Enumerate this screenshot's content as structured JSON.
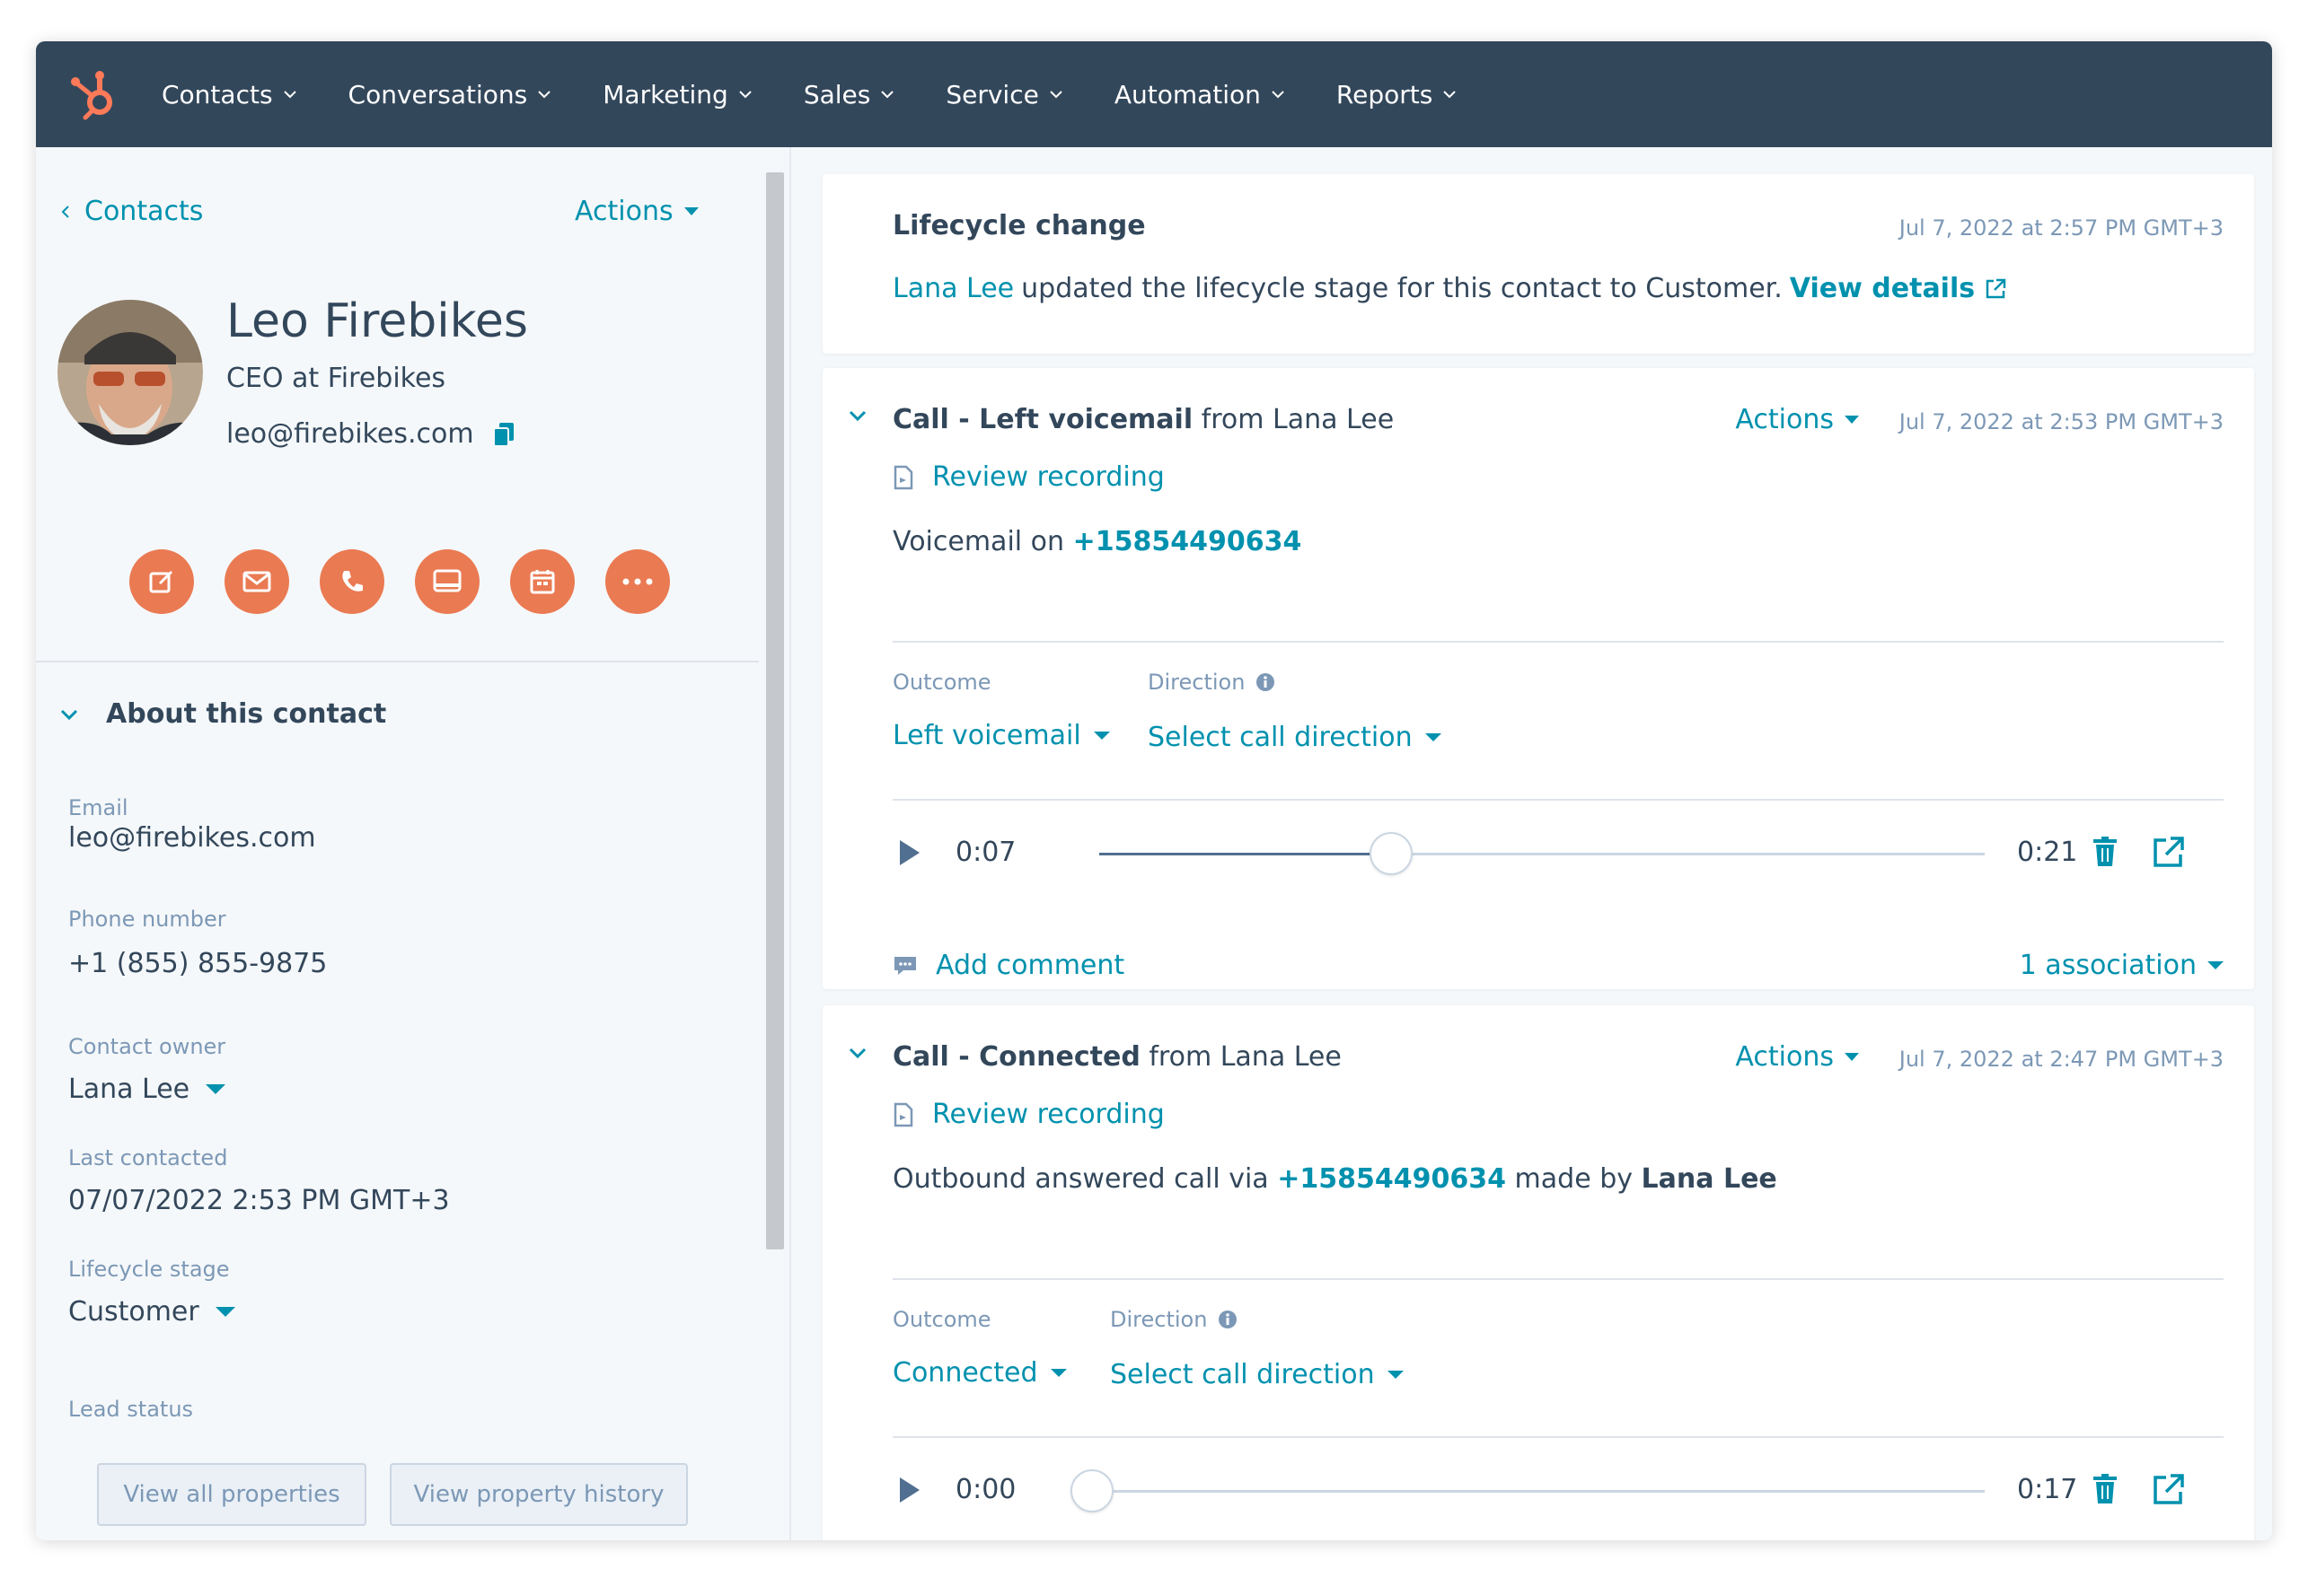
{
  "nav": {
    "items": [
      "Contacts",
      "Conversations",
      "Marketing",
      "Sales",
      "Service",
      "Automation",
      "Reports"
    ]
  },
  "contact": {
    "breadcrumb": "Contacts",
    "actions_label": "Actions",
    "name": "Leo Firebikes",
    "title": "CEO at Firebikes",
    "email": "leo@firebikes.com"
  },
  "about": {
    "heading": "About this contact",
    "email_label": "Email",
    "email_value": "leo@firebikes.com",
    "phone_label": "Phone number",
    "phone_value": "+1 (855) 855-9875",
    "owner_label": "Contact owner",
    "owner_value": "Lana Lee",
    "last_contacted_label": "Last contacted",
    "last_contacted_value": "07/07/2022 2:53 PM GMT+3",
    "lifecycle_label": "Lifecycle stage",
    "lifecycle_value": "Customer",
    "lead_status_label": "Lead status",
    "view_all_btn": "View all properties",
    "view_history_btn": "View property history"
  },
  "timeline": {
    "lifecycle": {
      "title": "Lifecycle change",
      "date": "Jul 7, 2022 at 2:57 PM GMT+3",
      "actor": "Lana Lee",
      "text": "updated the lifecycle stage for this contact to Customer.",
      "view_details": "View details"
    },
    "call1": {
      "title_bold": "Call - Left voicemail",
      "title_rest": "from Lana Lee",
      "actions_label": "Actions",
      "date": "Jul 7, 2022 at 2:53 PM GMT+3",
      "review": "Review recording",
      "body_prefix": "Voicemail on",
      "phone": "+15854490634",
      "outcome_label": "Outcome",
      "direction_label": "Direction",
      "outcome_value": "Left voicemail",
      "direction_value": "Select call direction",
      "time_current": "0:07",
      "time_total": "0:21",
      "progress": 0.33,
      "add_comment": "Add comment",
      "association": "1 association"
    },
    "call2": {
      "title_bold": "Call - Connected",
      "title_rest": "from Lana Lee",
      "actions_label": "Actions",
      "date": "Jul 7, 2022 at 2:47 PM GMT+3",
      "review": "Review recording",
      "body_prefix": "Outbound answered call via",
      "phone": "+15854490634",
      "body_mid": "made by",
      "body_actor": "Lana Lee",
      "outcome_label": "Outcome",
      "direction_label": "Direction",
      "outcome_value": "Connected",
      "direction_value": "Select call direction",
      "time_current": "0:00",
      "time_total": "0:17",
      "progress": 0.0
    }
  },
  "colors": {
    "nav_bg": "#33475b",
    "accent_link": "#0091ae",
    "action_orange": "#ea7a52",
    "logo_orange": "#ff7a59"
  },
  "icons": [
    "hubspot-logo-icon",
    "chevron-left-icon",
    "copy-icon",
    "note-icon",
    "email-icon",
    "phone-icon",
    "chat-icon",
    "calendar-icon",
    "more-icon",
    "chevron-down-icon",
    "external-link-icon",
    "recording-file-icon",
    "info-icon",
    "play-icon",
    "trash-icon",
    "comment-icon"
  ]
}
